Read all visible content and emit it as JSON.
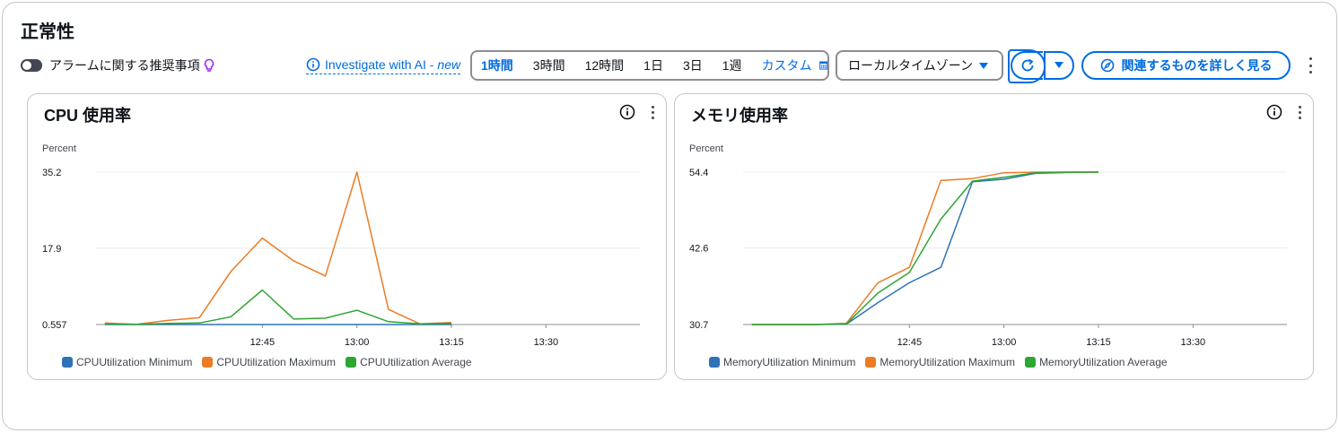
{
  "header": {
    "title": "正常性"
  },
  "toolbar": {
    "alarm_toggle_label": "アラームに関する推奨事項",
    "ai_link": {
      "label": "Investigate with AI -",
      "badge": "new"
    },
    "time_ranges": [
      {
        "label": "1時間",
        "active": true
      },
      {
        "label": "3時間",
        "active": false
      },
      {
        "label": "12時間",
        "active": false
      },
      {
        "label": "1日",
        "active": false
      },
      {
        "label": "3日",
        "active": false
      },
      {
        "label": "1週",
        "active": false
      }
    ],
    "custom_label": "カスタム",
    "timezone": "ローカルタイムゾーン",
    "explore_label": "関連するものを詳しく見る"
  },
  "colors": {
    "accent": "#006ce0",
    "minimum": "#2e73b8",
    "maximum": "#eb7c25",
    "average": "#2ea632",
    "grid": "#e9ebed"
  },
  "chart_data": [
    {
      "type": "line",
      "title": "CPU 使用率",
      "ylabel": "Percent",
      "ylim": [
        0.557,
        35.2
      ],
      "y_ticks": [
        "35.2",
        "17.9",
        "0.557"
      ],
      "x_ticks": [
        "12:45",
        "13:00",
        "13:15",
        "13:30"
      ],
      "x_minutes": [
        -25,
        -20,
        -15,
        -10,
        -5,
        0,
        5,
        10,
        15,
        20,
        25,
        30
      ],
      "series": [
        {
          "name": "CPUUtilization Minimum",
          "color": "#2e73b8",
          "values": [
            0.557,
            0.557,
            0.557,
            0.557,
            0.557,
            0.557,
            0.557,
            0.557,
            0.557,
            0.557,
            0.557,
            0.557
          ]
        },
        {
          "name": "CPUUtilization Maximum",
          "color": "#eb7c25",
          "values": [
            0.9,
            0.6,
            1.5,
            2.1,
            12.6,
            20.2,
            15.0,
            11.6,
            35.2,
            4.0,
            0.7,
            1.0
          ]
        },
        {
          "name": "CPUUtilization Average",
          "color": "#2ea632",
          "values": [
            0.7,
            0.6,
            0.8,
            0.9,
            2.3,
            8.4,
            1.8,
            2.0,
            3.8,
            1.2,
            0.7,
            0.8
          ]
        }
      ]
    },
    {
      "type": "line",
      "title": "メモリ使用率",
      "ylabel": "Percent",
      "ylim": [
        30.7,
        54.4
      ],
      "y_ticks": [
        "54.4",
        "42.6",
        "30.7"
      ],
      "x_ticks": [
        "12:45",
        "13:00",
        "13:15",
        "13:30"
      ],
      "x_minutes": [
        -25,
        -20,
        -15,
        -10,
        -5,
        0,
        5,
        10,
        15,
        20,
        25,
        30
      ],
      "series": [
        {
          "name": "MemoryUtilization Minimum",
          "color": "#2e73b8",
          "values": [
            30.7,
            30.7,
            30.7,
            30.75,
            34.1,
            37.2,
            39.6,
            52.9,
            53.3,
            54.2,
            54.35,
            54.4
          ]
        },
        {
          "name": "MemoryUtilization Maximum",
          "color": "#eb7c25",
          "values": [
            30.7,
            30.7,
            30.7,
            30.9,
            37.2,
            39.6,
            53.1,
            53.4,
            54.3,
            54.4,
            54.4,
            54.4
          ]
        },
        {
          "name": "MemoryUtilization Average",
          "color": "#2ea632",
          "values": [
            30.7,
            30.7,
            30.7,
            30.8,
            35.6,
            38.8,
            47.1,
            53.0,
            53.6,
            54.3,
            54.4,
            54.4
          ]
        }
      ]
    }
  ]
}
